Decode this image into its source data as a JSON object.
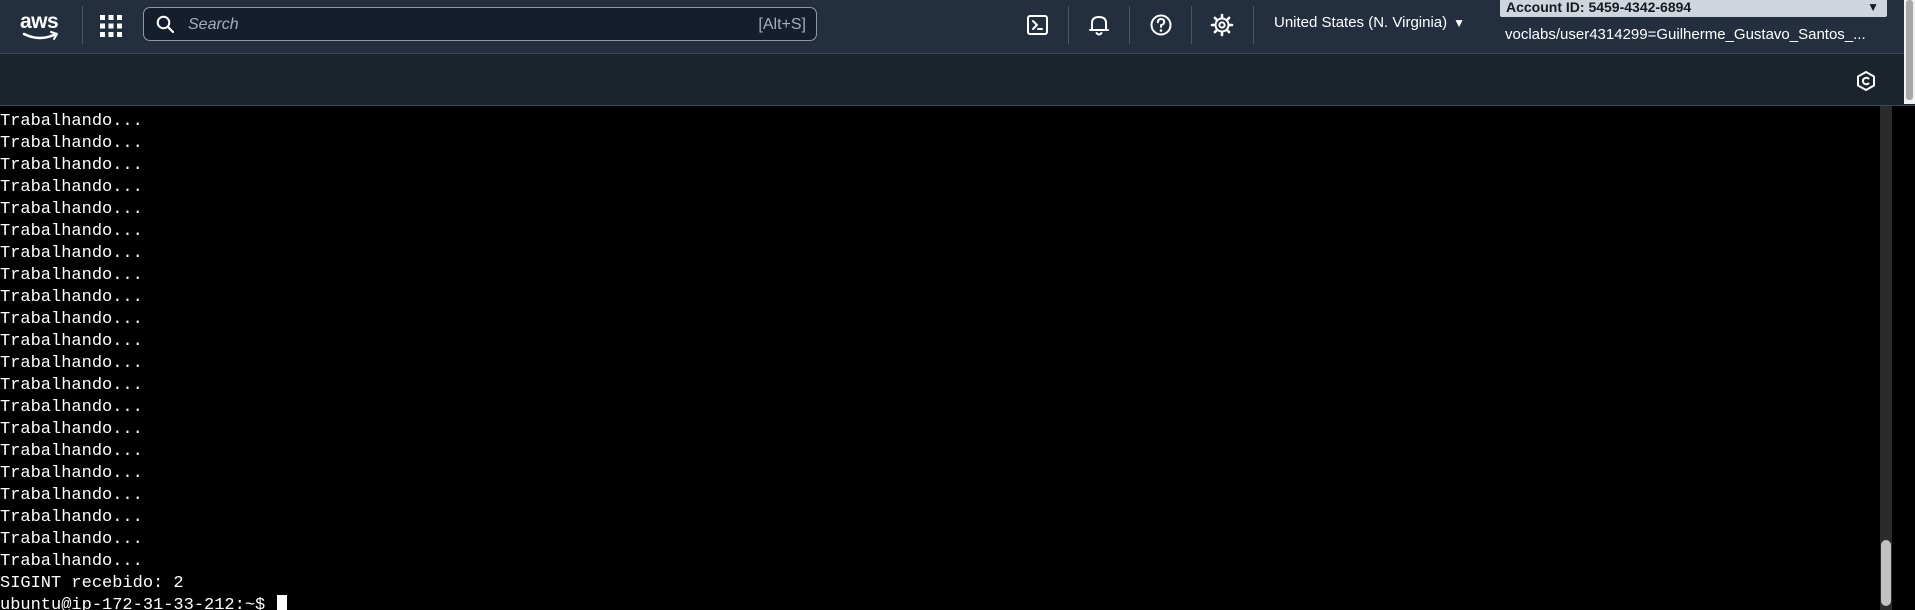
{
  "header": {
    "logo_text": "aws",
    "search": {
      "placeholder": "Search",
      "shortcut": "[Alt+S]"
    },
    "icons": [
      "cloudshell-icon",
      "bell-icon",
      "help-icon",
      "gear-icon"
    ],
    "region": "United States (N. Virginia)",
    "account_id": "Account ID: 5459-4342-6894",
    "user": "voclabs/user4314299=Guilherme_Gustavo_Santos_..."
  },
  "terminal": {
    "output_lines": [
      "Trabalhando...",
      "Trabalhando...",
      "Trabalhando...",
      "Trabalhando...",
      "Trabalhando...",
      "Trabalhando...",
      "Trabalhando...",
      "Trabalhando...",
      "Trabalhando...",
      "Trabalhando...",
      "Trabalhando...",
      "Trabalhando...",
      "Trabalhando...",
      "Trabalhando...",
      "Trabalhando...",
      "Trabalhando...",
      "Trabalhando...",
      "Trabalhando...",
      "Trabalhando...",
      "Trabalhando...",
      "Trabalhando...",
      "SIGINT recebido: 2"
    ],
    "prompt": "ubuntu@ip-172-31-33-212:~$ "
  },
  "colors": {
    "topbar": "#232f3e",
    "subbar": "#1b232d",
    "terminal_bg": "#000000",
    "terminal_fg": "#ffffff",
    "account_box": "#cfd5dc"
  }
}
